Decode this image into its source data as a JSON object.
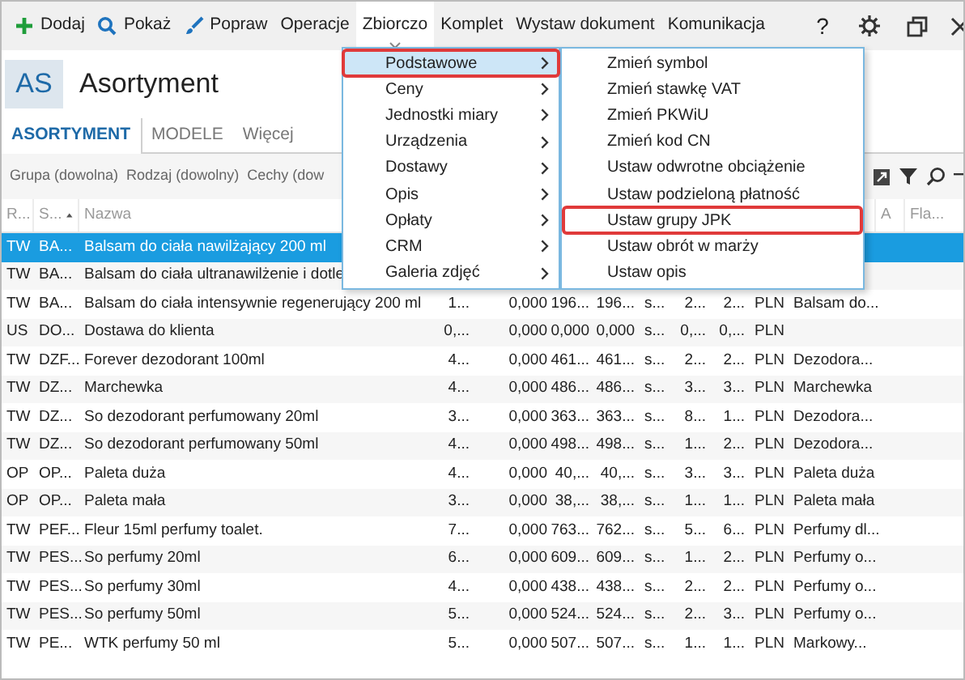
{
  "toolbar": [
    {
      "label": "Dodaj",
      "kind": "plus",
      "selected": false
    },
    {
      "label": "Pokaż",
      "kind": "search",
      "selected": false
    },
    {
      "label": "Popraw",
      "kind": "brush",
      "selected": false
    },
    {
      "label": "Operacje",
      "kind": "text",
      "selected": false
    },
    {
      "label": "Zbiorczo",
      "kind": "text",
      "selected": true
    },
    {
      "label": "Komplet",
      "kind": "text",
      "selected": false
    },
    {
      "label": "Wystaw dokument",
      "kind": "text",
      "selected": false
    },
    {
      "label": "Komunikacja",
      "kind": "text",
      "selected": false
    }
  ],
  "window_controls": [
    "?"
  ],
  "header": {
    "badge": "AS",
    "title": "Asortyment"
  },
  "tabs": [
    {
      "label": "ASORTYMENT",
      "selected": true
    },
    {
      "label": "MODELE",
      "selected": false
    },
    {
      "label": "Więcej",
      "selected": false
    }
  ],
  "filters": [
    "Grupa (dowolna)",
    "Rodzaj (dowolny)",
    "Cechy (dow"
  ],
  "table": {
    "columns": [
      "R...",
      "S...",
      "Nazwa",
      null,
      null,
      null,
      null,
      null,
      null,
      null,
      null,
      null,
      "A",
      "Fla..."
    ],
    "rows": [
      {
        "selected": true,
        "cells": [
          "TW",
          "BA...",
          "Balsam do ciała nawilżający 200 ml",
          null,
          null,
          null,
          null,
          null,
          null,
          null,
          null,
          null,
          null,
          null
        ]
      },
      {
        "selected": false,
        "cells": [
          "TW",
          "BA...",
          "Balsam do ciała ultranawilżenie i dotle",
          null,
          null,
          null,
          null,
          null,
          null,
          null,
          null,
          null,
          null,
          null
        ]
      },
      {
        "selected": false,
        "cells": [
          "TW",
          "BA...",
          "Balsam do ciała intensywnie regenerujący 200 ml",
          "1...",
          "0,000",
          "196...",
          "196...",
          "s...",
          "2...",
          "2...",
          "PLN",
          "Balsam do...",
          null,
          null
        ]
      },
      {
        "selected": false,
        "cells": [
          "US",
          "DO...",
          "Dostawa do klienta",
          "0,...",
          "0,000",
          "0,000",
          "0,000",
          "s...",
          "0,...",
          "0,...",
          "PLN",
          null,
          null,
          null
        ]
      },
      {
        "selected": false,
        "cells": [
          "TW",
          "DZF...",
          "Forever dezodorant 100ml",
          "4...",
          "0,000",
          "461...",
          "461...",
          "s...",
          "2...",
          "2...",
          "PLN",
          "Dezodora...",
          null,
          null
        ]
      },
      {
        "selected": false,
        "cells": [
          "TW",
          "DZ...",
          "Marchewka",
          "4...",
          "0,000",
          "486...",
          "486...",
          "s...",
          "3...",
          "3...",
          "PLN",
          "Marchewka",
          null,
          null
        ]
      },
      {
        "selected": false,
        "cells": [
          "TW",
          "DZ...",
          "So dezodorant perfumowany 20ml",
          "3...",
          "0,000",
          "363...",
          "363...",
          "s...",
          "8...",
          "1...",
          "PLN",
          "Dezodora...",
          null,
          null
        ]
      },
      {
        "selected": false,
        "cells": [
          "TW",
          "DZ...",
          "So dezodorant perfumowany 50ml",
          "4...",
          "0,000",
          "498...",
          "498...",
          "s...",
          "1...",
          "2...",
          "PLN",
          "Dezodora...",
          null,
          null
        ]
      },
      {
        "selected": false,
        "cells": [
          "OP",
          "OP...",
          "Paleta duża",
          "4...",
          "0,000",
          "40,...",
          "40,...",
          "s...",
          "3...",
          "3...",
          "PLN",
          "Paleta duża",
          null,
          null
        ]
      },
      {
        "selected": false,
        "cells": [
          "OP",
          "OP...",
          "Paleta mała",
          "3...",
          "0,000",
          "38,...",
          "38,...",
          "s...",
          "1...",
          "1...",
          "PLN",
          "Paleta mała",
          null,
          null
        ]
      },
      {
        "selected": false,
        "cells": [
          "TW",
          "PEF...",
          "Fleur 15ml perfumy toalet.",
          "7...",
          "0,000",
          "763...",
          "762...",
          "s...",
          "5...",
          "6...",
          "PLN",
          "Perfumy dl...",
          null,
          null
        ]
      },
      {
        "selected": false,
        "cells": [
          "TW",
          "PES...",
          "So perfumy 20ml",
          "6...",
          "0,000",
          "609...",
          "609...",
          "s...",
          "1...",
          "2...",
          "PLN",
          "Perfumy o...",
          null,
          null
        ]
      },
      {
        "selected": false,
        "cells": [
          "TW",
          "PES...",
          "So perfumy 30ml",
          "4...",
          "0,000",
          "438...",
          "438...",
          "s...",
          "2...",
          "2...",
          "PLN",
          "Perfumy o...",
          null,
          null
        ]
      },
      {
        "selected": false,
        "cells": [
          "TW",
          "PES...",
          "So perfumy 50ml",
          "5...",
          "0,000",
          "524...",
          "524...",
          "s...",
          "2...",
          "3...",
          "PLN",
          "Perfumy o...",
          null,
          null
        ]
      },
      {
        "selected": false,
        "cells": [
          "TW",
          "PE...",
          "WTK perfumy 50 ml",
          "5...",
          "0,000",
          "507...",
          "507...",
          "s...",
          "1...",
          "1...",
          "PLN",
          "Markowy...",
          null,
          null
        ]
      }
    ]
  },
  "menu": [
    {
      "label": "Podstawowe",
      "selected": true,
      "marked": true
    },
    {
      "label": "Ceny",
      "selected": false,
      "marked": false
    },
    {
      "label": "Jednostki miary",
      "selected": false,
      "marked": false
    },
    {
      "label": "Urządzenia",
      "selected": false,
      "marked": false
    },
    {
      "label": "Dostawy",
      "selected": false,
      "marked": false
    },
    {
      "label": "Opis",
      "selected": false,
      "marked": false
    },
    {
      "label": "Opłaty",
      "selected": false,
      "marked": false
    },
    {
      "label": "CRM",
      "selected": false,
      "marked": false
    },
    {
      "label": "Galeria zdjęć",
      "selected": false,
      "marked": false
    }
  ],
  "submenu": [
    {
      "label": "Zmień symbol",
      "marked": false
    },
    {
      "label": "Zmień stawkę VAT",
      "marked": false
    },
    {
      "label": "Zmień PKWiU",
      "marked": false
    },
    {
      "label": "Zmień kod CN",
      "marked": false
    },
    {
      "label": "Ustaw odwrotne obciążenie",
      "marked": false
    },
    {
      "label": "Ustaw podzieloną płatność",
      "marked": false
    },
    {
      "label": "Ustaw grupy JPK",
      "marked": true
    },
    {
      "label": "Ustaw obrót w marży",
      "marked": false
    },
    {
      "label": "Ustaw opis",
      "marked": false
    }
  ]
}
